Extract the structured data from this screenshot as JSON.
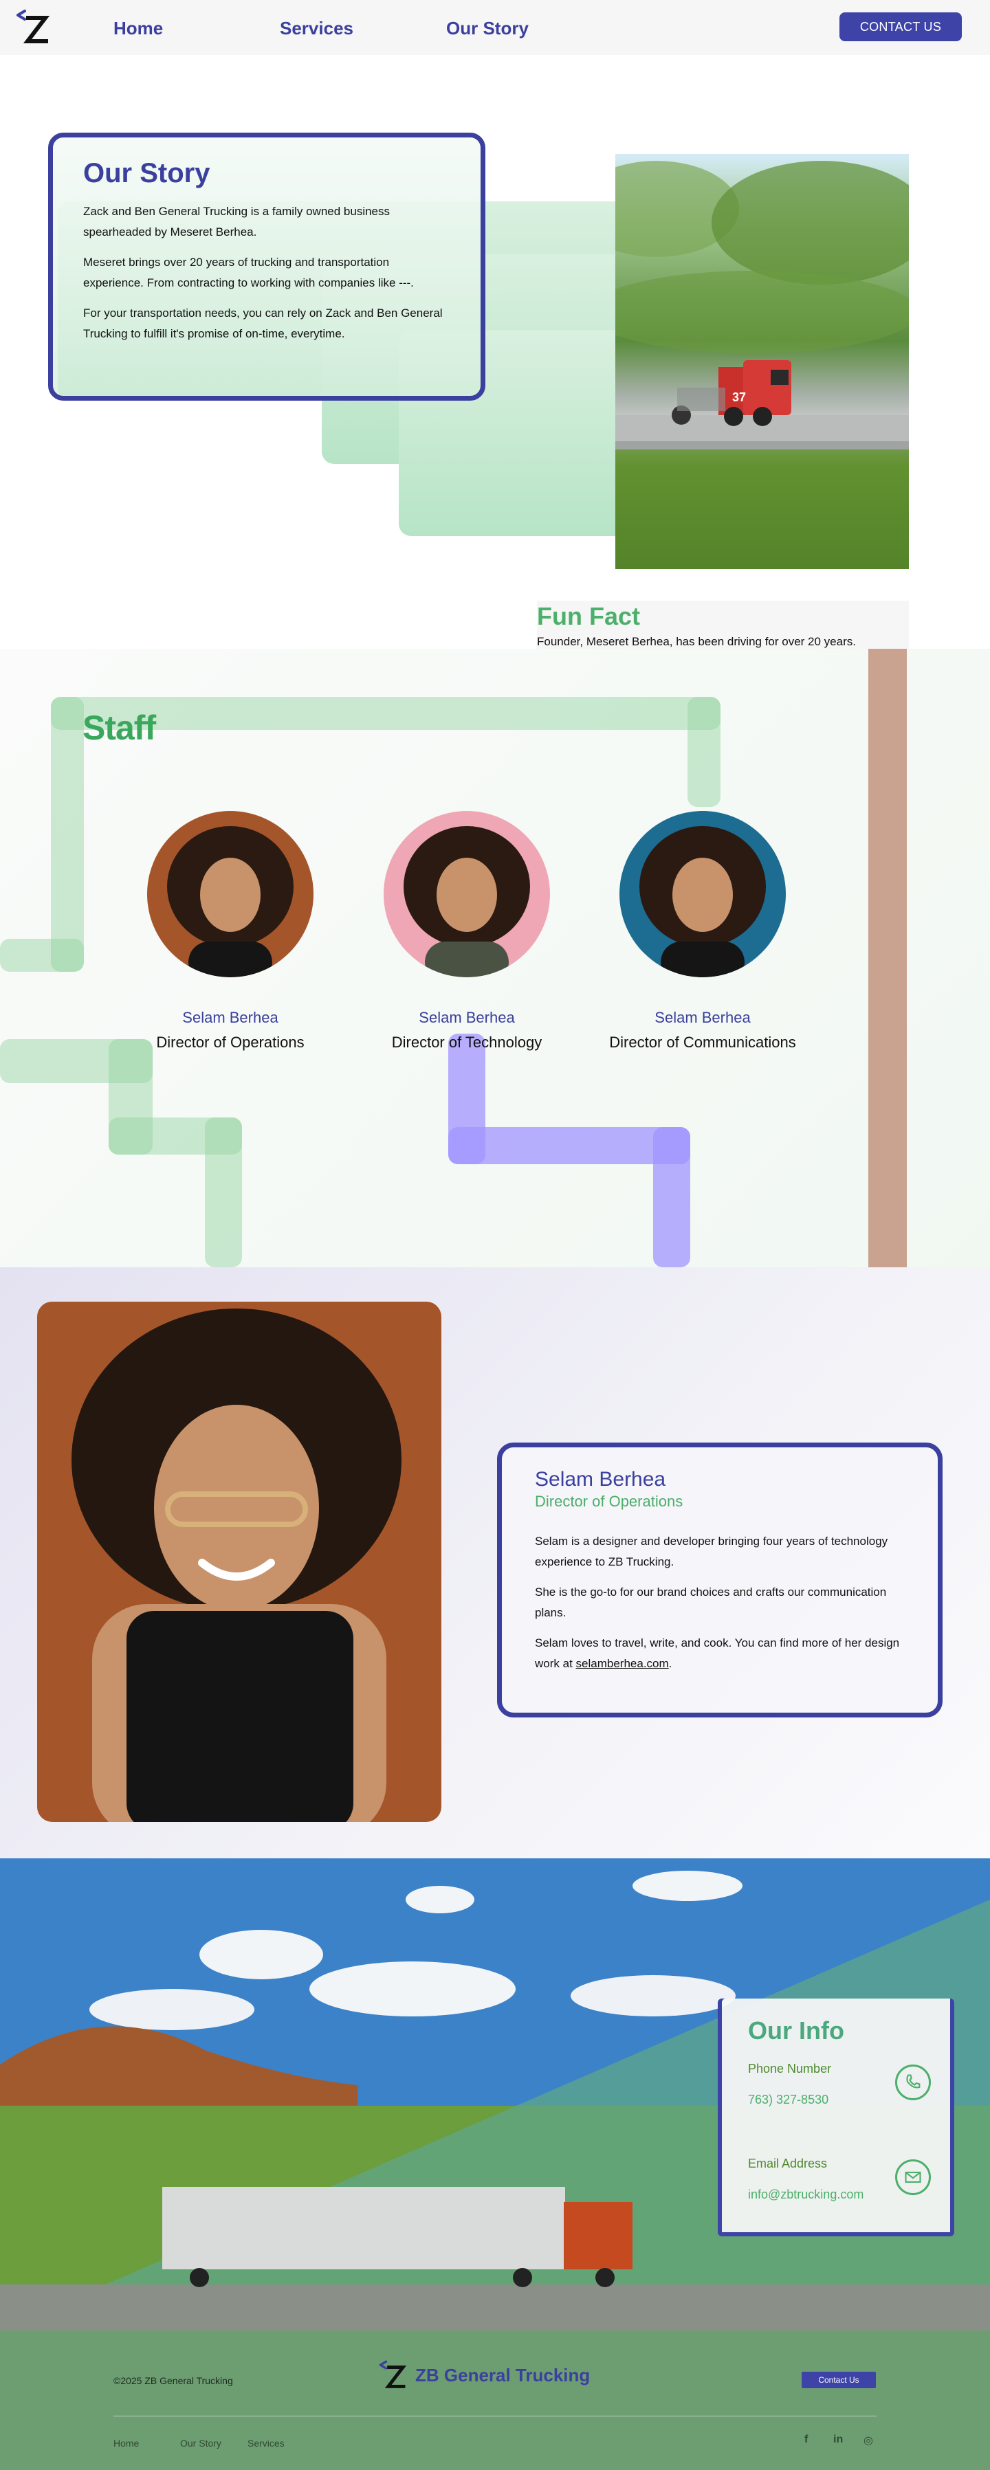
{
  "colors": {
    "brand": "#3b3f9e",
    "accent_green": "#4caf6a",
    "button": "#3e43a8"
  },
  "header": {
    "logo_letter": "Z",
    "nav": [
      "Home",
      "Services",
      "Our Story"
    ],
    "contact_label": "CONTACT US"
  },
  "story": {
    "title": "Our Story",
    "paragraphs": [
      "Zack and Ben General Trucking is a family owned business spearheaded by Meseret Berhea.",
      "Meseret brings over 20 years of trucking and transportation experience. From contracting to working with companies like ---.",
      "For your transportation needs, you can rely on Zack and Ben General Trucking to fulfill it's promise of on-time, everytime."
    ],
    "truck_number": "37",
    "fun_fact_title": "Fun Fact",
    "fun_fact_text": "Founder, Meseret Berhea, has been driving for over 20 years."
  },
  "staff": {
    "title": "Staff",
    "members": [
      {
        "name": "Selam Berhea",
        "role": "Director of Operations",
        "bg": "#a5552a"
      },
      {
        "name": "Selam Berhea",
        "role": "Director of Technology",
        "bg": "#f0a7b5"
      },
      {
        "name": "Selam Berhea",
        "role": "Director of Communications",
        "bg": "#1d6c92"
      }
    ]
  },
  "profile": {
    "name": "Selam Berhea",
    "role": "Director of Operations",
    "p1": "Selam is a designer and developer bringing four years of technology experience to ZB Trucking.",
    "p2": "She is the go-to for our brand choices and crafts our communication plans.",
    "p3_prefix": "Selam loves to travel, write, and cook. You can find more of her design work at ",
    "p3_link": "selamberhea.com",
    "p3_suffix": "."
  },
  "info": {
    "title": "Our Info",
    "phone_label": "Phone Number",
    "phone_value": "763) 327-8530",
    "email_label": "Email Address",
    "email_value": "info@zbtrucking.com",
    "phone_icon": "phone-icon",
    "email_icon": "mail-icon"
  },
  "footer": {
    "copyright": "©2025 ZB General Trucking",
    "logo_text": "ZB General Trucking",
    "contact_label": "Contact Us",
    "links": [
      "Home",
      "Our Story",
      "Services"
    ],
    "social": [
      "f",
      "in",
      "◎"
    ]
  }
}
